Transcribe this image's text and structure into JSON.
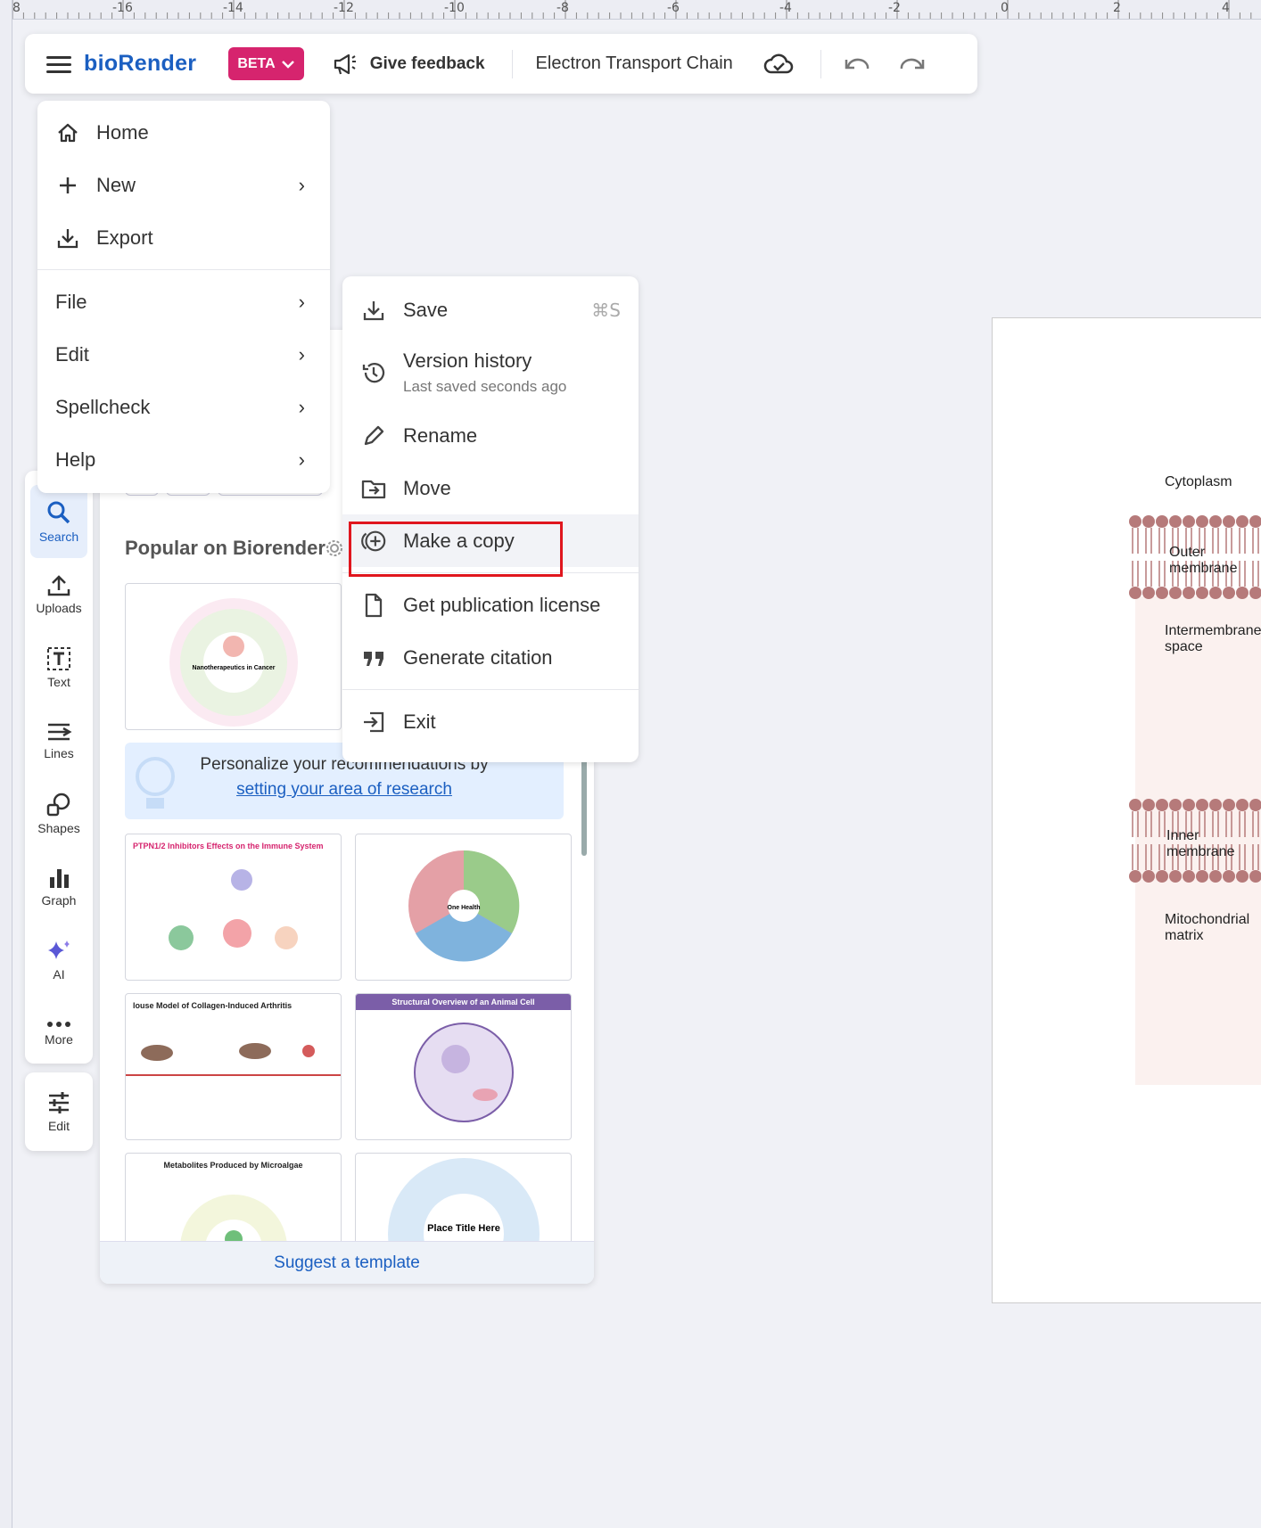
{
  "ruler": {
    "labels": [
      "8",
      "-16",
      "-14",
      "-12",
      "-10",
      "-8",
      "-6",
      "-4",
      "-2",
      "0",
      "2",
      "4"
    ]
  },
  "topbar": {
    "logo": "bioRender",
    "beta_label": "BETA",
    "feedback_label": "Give feedback",
    "doc_title": "Electron Transport Chain",
    "icons": [
      "hamburger-icon",
      "chevron-down-icon",
      "megaphone-icon",
      "cloud-check-icon",
      "undo-icon",
      "redo-icon"
    ]
  },
  "main_menu": {
    "items": [
      {
        "label": "Home",
        "icon": "home-icon"
      },
      {
        "label": "New",
        "icon": "plus-icon",
        "submenu": true
      },
      {
        "label": "Export",
        "icon": "export-icon"
      },
      {
        "label": "File",
        "submenu": true
      },
      {
        "label": "Edit",
        "submenu": true
      },
      {
        "label": "Spellcheck",
        "submenu": true
      },
      {
        "label": "Help",
        "submenu": true
      }
    ]
  },
  "file_menu": {
    "items": [
      {
        "label": "Save",
        "shortcut": "⌘S",
        "icon": "save-icon"
      },
      {
        "label": "Version history",
        "sublabel": "Last saved seconds ago",
        "icon": "history-icon"
      },
      {
        "label": "Rename",
        "icon": "pencil-icon"
      },
      {
        "label": "Move",
        "icon": "move-folder-icon"
      },
      {
        "label": "Make a copy",
        "icon": "copy-plus-icon",
        "highlighted": true
      },
      {
        "label": "Get publication license",
        "icon": "document-icon"
      },
      {
        "label": "Generate citation",
        "icon": "quote-icon"
      },
      {
        "label": "Exit",
        "icon": "exit-icon"
      }
    ]
  },
  "toolbar": {
    "tools": [
      {
        "label": "Search",
        "icon": "search-icon",
        "active": true
      },
      {
        "label": "Uploads",
        "icon": "upload-icon"
      },
      {
        "label": "Text",
        "icon": "text-icon"
      },
      {
        "label": "Lines",
        "icon": "lines-icon"
      },
      {
        "label": "Shapes",
        "icon": "shapes-icon"
      },
      {
        "label": "Graph",
        "icon": "bar-graph-icon"
      },
      {
        "label": "AI",
        "icon": "sparkle-icon"
      },
      {
        "label": "More",
        "icon": "more-icon"
      }
    ],
    "edit_label": "Edit"
  },
  "panel": {
    "title": "Popular on Biorender",
    "personalize_text": "Personalize your recommendations by",
    "personalize_link": "setting your area of research",
    "suggest_label": "Suggest a template",
    "thumbs": [
      {
        "title": "Nanotherapeutics in Cancer"
      },
      {
        "title": "PTPN1/2 Inhibitors Effects on the Immune System"
      },
      {
        "title": "One Health"
      },
      {
        "title": "louse Model of Collagen-Induced Arthritis"
      },
      {
        "title": "Structural Overview of an Animal Cell"
      },
      {
        "title": "Metabolites Produced by Microalgae"
      },
      {
        "title": "Place Title Here"
      }
    ]
  },
  "canvas": {
    "labels": {
      "cytoplasm": "Cytoplasm",
      "outer1": "Outer",
      "outer2": "membrane",
      "inter1": "Intermembrane",
      "inter2": "space",
      "inner1": "Inner",
      "inner2": "membrane",
      "matrix1": "Mitochondrial",
      "matrix2": "matrix"
    }
  },
  "colors": {
    "accent": "#1b5fc1",
    "beta": "#d6246e",
    "highlight": "#e0161e",
    "lipid": "#b67a7a"
  }
}
